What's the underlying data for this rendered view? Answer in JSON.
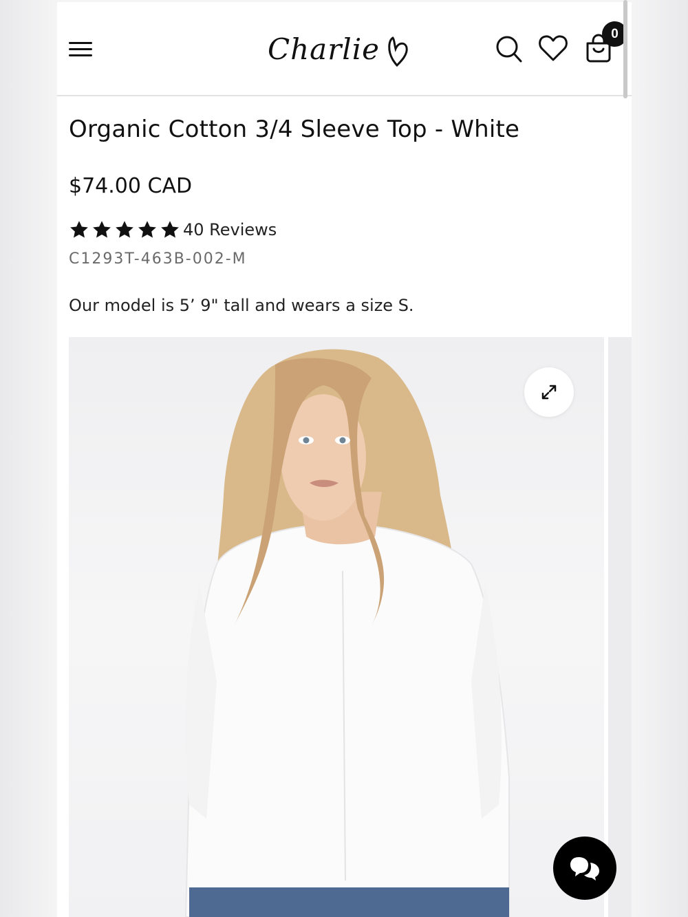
{
  "header": {
    "logo_text": "Charlie",
    "cart_count": "0"
  },
  "product": {
    "title": "Organic Cotton 3/4 Sleeve Top - White",
    "price": "$74.00 CAD",
    "rating_stars": 5,
    "reviews_label": "40 Reviews",
    "sku": "C1293T-463B-002-M",
    "model_note": "Our model is 5’ 9\" tall and wears a size S."
  },
  "colors": {
    "text": "#111111",
    "muted": "#6a6a6a",
    "chat_button": "#000000"
  },
  "icons": [
    "hamburger-menu-icon",
    "search-icon",
    "heart-icon",
    "shopping-bag-icon",
    "expand-icon",
    "chat-icon",
    "star-icon"
  ]
}
